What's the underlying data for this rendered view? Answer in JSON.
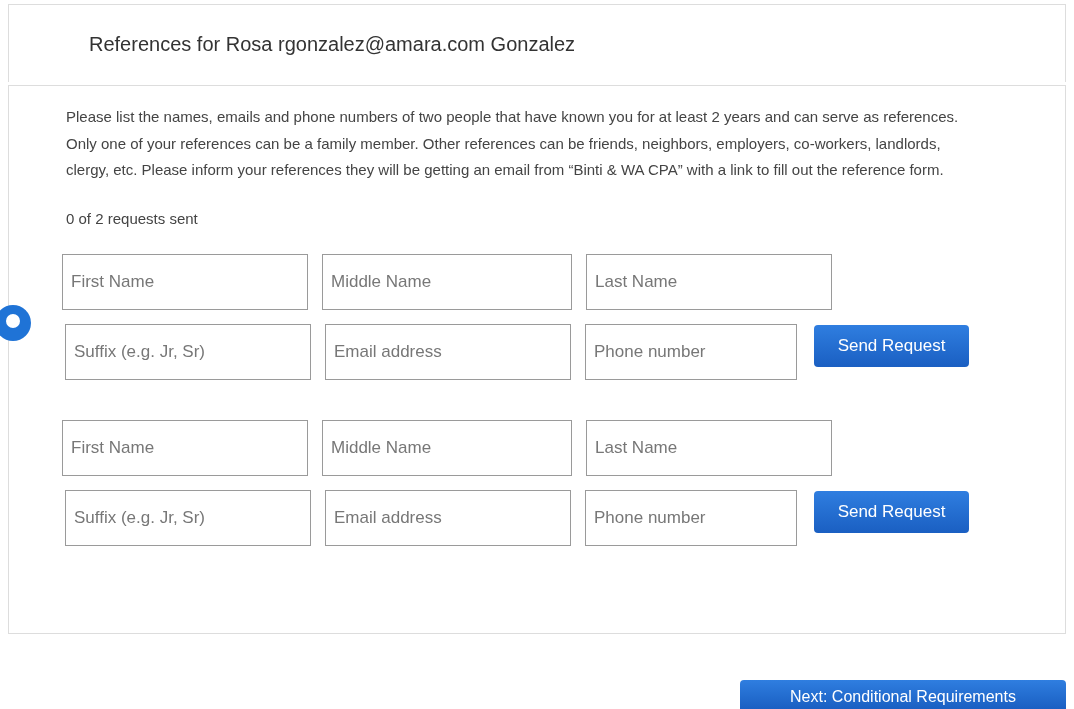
{
  "header": {
    "title": "References for Rosa rgonzalez@amara.com Gonzalez"
  },
  "instructions": "Please list the names, emails and phone numbers of two people that have known you for at least 2 years and can serve as references. Only one of your references can be a family member. Other references can be friends, neighbors, employers, co-workers, landlords, clergy, etc. Please inform your references they will be getting an email from “Binti & WA CPA” with a link to fill out the reference form.",
  "progress": "0 of 2 requests sent",
  "references": [
    {
      "fields": [
        {
          "placeholder": "First Name"
        },
        {
          "placeholder": "Middle Name"
        },
        {
          "placeholder": "Last Name"
        },
        {
          "placeholder": "Suffix (e.g. Jr, Sr)"
        },
        {
          "placeholder": "Email address"
        },
        {
          "placeholder": "Phone number"
        }
      ],
      "button": "Send Request"
    },
    {
      "fields": [
        {
          "placeholder": "First Name"
        },
        {
          "placeholder": "Middle Name"
        },
        {
          "placeholder": "Last Name"
        },
        {
          "placeholder": "Suffix (e.g. Jr, Sr)"
        },
        {
          "placeholder": "Email address"
        },
        {
          "placeholder": "Phone number"
        }
      ],
      "button": "Send Request"
    }
  ],
  "next_button": "Next: Conditional Requirements"
}
